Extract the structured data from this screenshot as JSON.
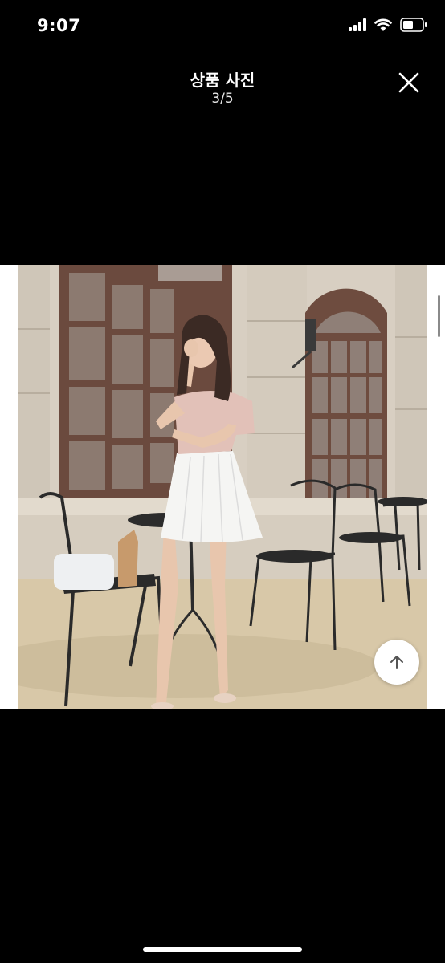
{
  "status_bar": {
    "time": "9:07",
    "icons": [
      "cellular-signal-icon",
      "wifi-icon",
      "battery-icon"
    ]
  },
  "header": {
    "title": "상품 사진",
    "counter": "3/5",
    "close_icon": "close-icon"
  },
  "photo": {
    "index": 3,
    "total": 5,
    "image_name": "product-photo"
  },
  "controls": {
    "scroll_top_icon": "arrow-up-icon"
  },
  "colors": {
    "background": "#000000",
    "text": "#ffffff",
    "frame": "#ffffff"
  }
}
